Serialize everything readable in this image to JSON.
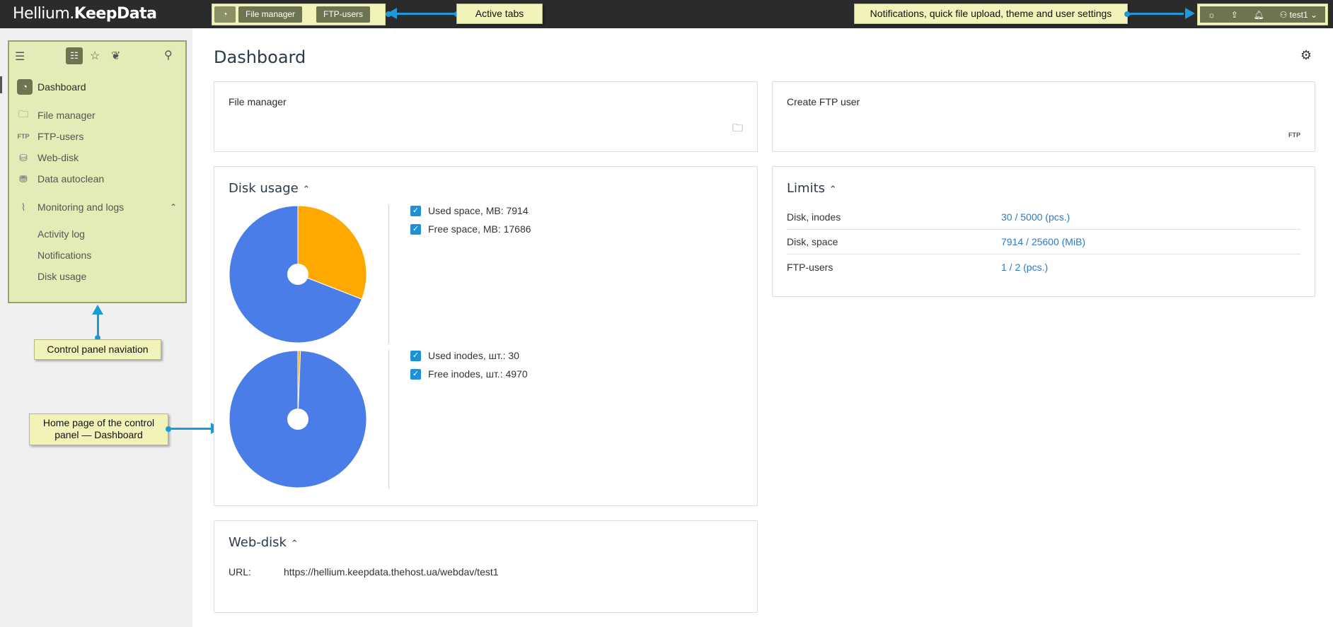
{
  "app": {
    "brand_light": "Hellium.",
    "brand_bold": "KeepData"
  },
  "tabs": [
    {
      "label": "File manager"
    },
    {
      "label": "FTP-users"
    }
  ],
  "user": {
    "name": "test1"
  },
  "sidebar": {
    "items": [
      {
        "label": "Dashboard"
      },
      {
        "label": "File manager"
      },
      {
        "label": "FTP-users"
      },
      {
        "label": "Web-disk"
      },
      {
        "label": "Data autoclean"
      },
      {
        "label": "Monitoring and logs"
      }
    ],
    "subitems": [
      {
        "label": "Activity log"
      },
      {
        "label": "Notifications"
      },
      {
        "label": "Disk usage"
      }
    ]
  },
  "page": {
    "title": "Dashboard"
  },
  "cards": {
    "file_manager": "File manager",
    "create_ftp": "Create FTP user",
    "disk_usage": "Disk usage",
    "limits": "Limits",
    "web_disk": "Web-disk"
  },
  "disk": {
    "used_space_label": "Used space, МВ: 7914",
    "free_space_label": "Free space, МВ: 17686",
    "used_inodes_label": "Used inodes, шт.: 30",
    "free_inodes_label": "Free inodes, шт.: 4970"
  },
  "limits": [
    {
      "label": "Disk, inodes",
      "value": "30 / 5000 (pcs.)"
    },
    {
      "label": "Disk, space",
      "value": "7914 / 25600 (MiB)"
    },
    {
      "label": "FTP-users",
      "value": "1 / 2 (pcs.)"
    }
  ],
  "webdisk": {
    "url_label": "URL:",
    "url": "https://hellium.keepdata.thehost.ua/webdav/test1"
  },
  "annotations": {
    "active_tabs": "Active tabs",
    "top_right": "Notifications, quick file upload, theme and user settings",
    "nav": "Control panel naviation",
    "home_line1": "Home page of the control",
    "home_line2": "panel — Dashboard"
  },
  "chart_data": [
    {
      "type": "pie",
      "categories": [
        "Used space, МВ",
        "Free space, МВ"
      ],
      "values": [
        7914,
        17686
      ],
      "colors": [
        "#ffa800",
        "#4a7de8"
      ]
    },
    {
      "type": "pie",
      "categories": [
        "Used inodes, шт.",
        "Free inodes, шт."
      ],
      "values": [
        30,
        4970
      ],
      "colors": [
        "#ffa800",
        "#4a7de8"
      ]
    }
  ]
}
